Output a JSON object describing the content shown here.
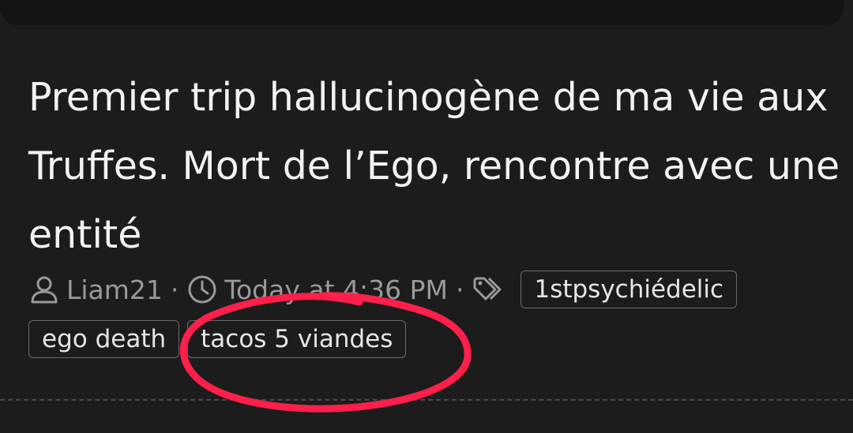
{
  "thread": {
    "title": "Premier trip hallucinogène de ma vie aux Truffes. Mort de l’Ego, rencontre avec une entité",
    "author": "Liam21",
    "date": "Today at 4:36 PM",
    "separator": "·",
    "tags": [
      "1stpsychiédelic",
      "ego death",
      "tacos 5 viandes"
    ]
  },
  "icons": {
    "author": "user-icon",
    "date": "clock-icon",
    "tags": "tag-icon"
  },
  "colors": {
    "background": "#1c1c1c",
    "annotation_circle": "#ff1f4b"
  }
}
